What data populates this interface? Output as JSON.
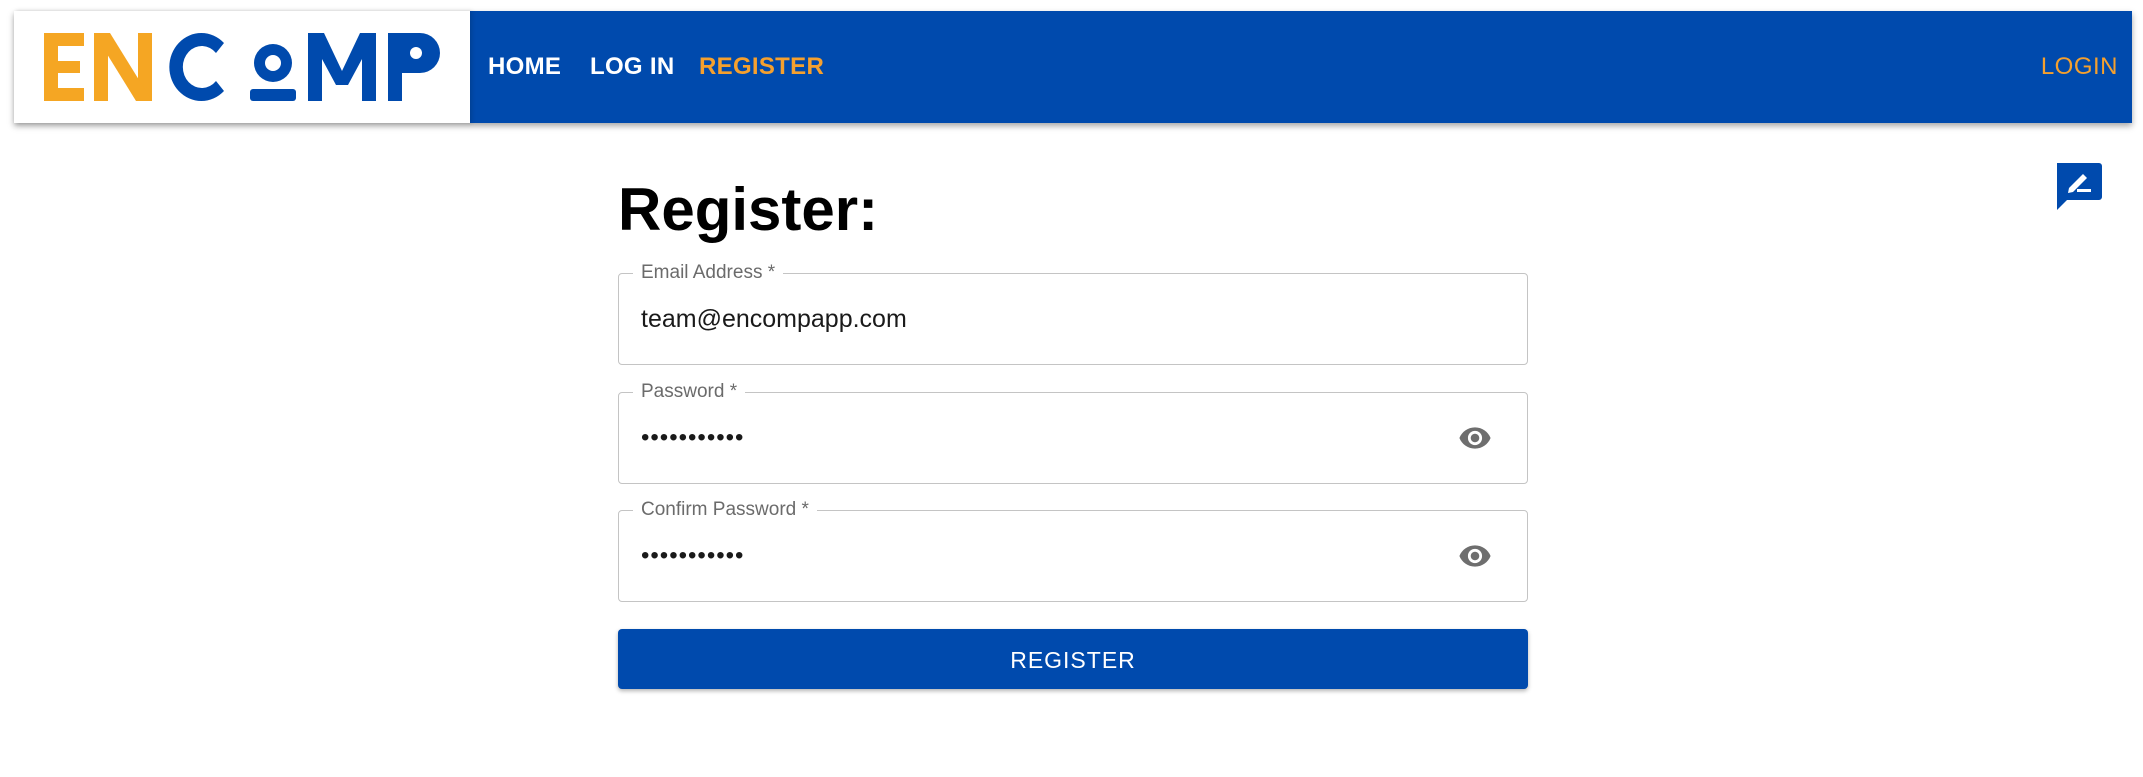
{
  "navbar": {
    "logo_text": "ENCOMP",
    "links": [
      "HOME",
      "LOG IN",
      "REGISTER"
    ],
    "active_link": "REGISTER",
    "login_label": "LOGIN"
  },
  "form": {
    "title": "Register:",
    "email": {
      "label": "Email Address *",
      "value": "team@encompapp.com"
    },
    "password": {
      "label": "Password *",
      "value": "•••••••••••"
    },
    "confirm_password": {
      "label": "Confirm Password *",
      "value": "•••••••••••"
    },
    "submit_label": "REGISTER"
  },
  "icons": {
    "password_toggle": "eye-icon",
    "confirm_toggle": "eye-icon",
    "feedback": "feedback-edit-icon"
  },
  "colors": {
    "brand_blue": "#004aad",
    "accent_orange": "#f5a02e"
  }
}
